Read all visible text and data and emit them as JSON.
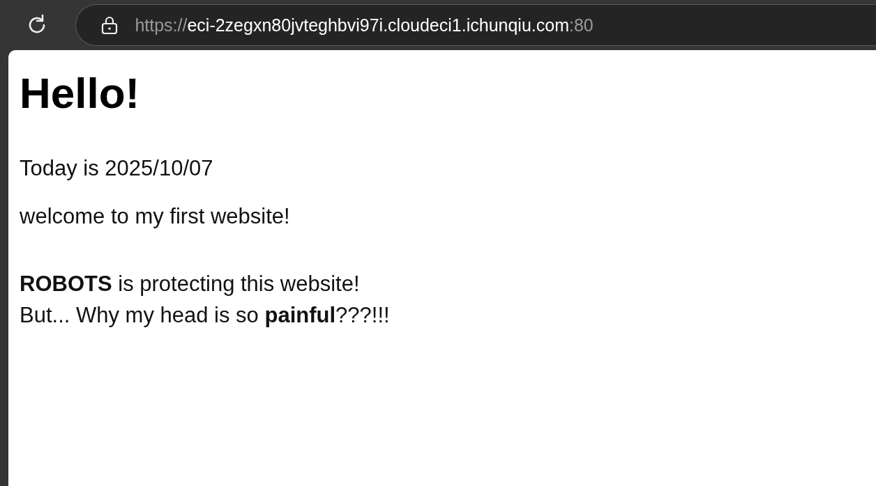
{
  "toolbar": {
    "address": {
      "scheme": "https://",
      "host": "eci-2zegxn80jvteghbvi97i.cloudeci1.ichunqiu.com",
      "port": ":80"
    }
  },
  "page": {
    "heading": "Hello!",
    "paragraphs": [
      {
        "lines": [
          "Today is 2025/10/07"
        ]
      },
      {
        "lines": [
          "welcome to my first website!"
        ]
      },
      {
        "lines": [
          "**ROBOTS** is protecting this website!",
          "But... Why my head is so **painful**???!!!"
        ]
      }
    ]
  }
}
